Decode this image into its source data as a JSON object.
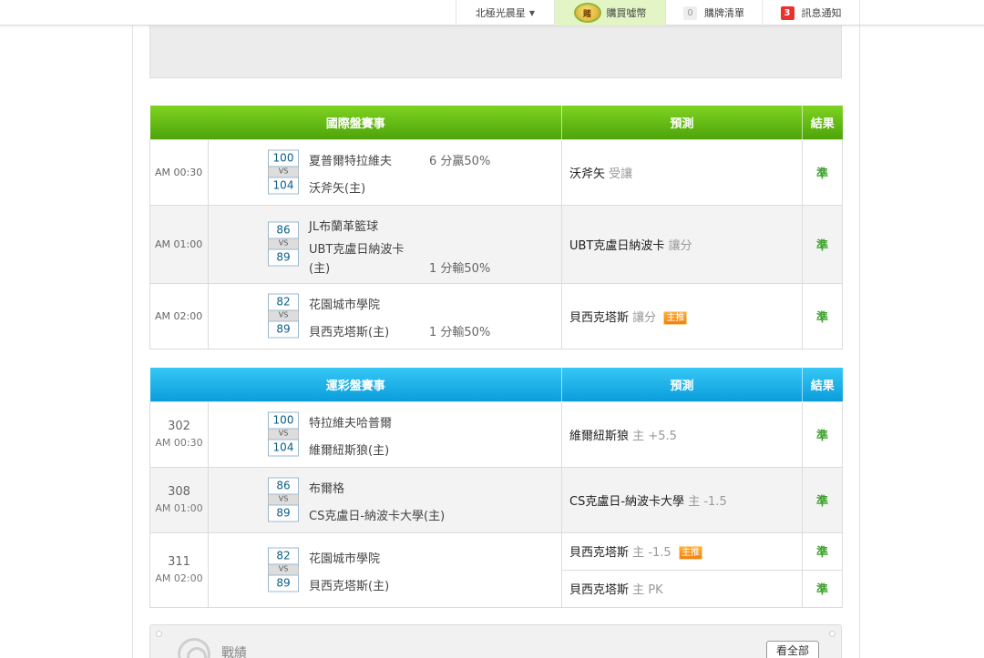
{
  "nav": {
    "user": "北極光晨星",
    "buy_icon": "賭",
    "buy": "購買噓幣",
    "cart_count": "0",
    "cart": "購牌清單",
    "msg_count": "3",
    "messages": "訊息通知"
  },
  "intl": {
    "headers": [
      "國際盤賽事",
      "預測",
      "結果"
    ],
    "rows": [
      {
        "time": "AM 00:30",
        "score_a": "100",
        "vs": "VS",
        "score_b": "104",
        "team_a": "夏普爾特拉維夫",
        "team_b": "沃斧矢(主)",
        "record": "6 分贏50%",
        "pick": "沃斧矢",
        "type": "受讓",
        "result": "準"
      },
      {
        "time": "AM 01:00",
        "score_a": "86",
        "vs": "VS",
        "score_b": "89",
        "team_a": "JL布蘭革籃球",
        "team_b": "UBT克盧日納波卡",
        "team_b2": "(主)",
        "record": "1 分輸50%",
        "pick": "UBT克盧日納波卡",
        "type": "讓分",
        "result": "準"
      },
      {
        "time": "AM 02:00",
        "score_a": "82",
        "vs": "VS",
        "score_b": "89",
        "team_a": "花園城市學院",
        "team_b": "貝西克塔斯(主)",
        "record": "1 分輸50%",
        "pick": "貝西克塔斯",
        "type": "讓分",
        "badge": "主推",
        "result": "準"
      }
    ]
  },
  "lottery": {
    "headers": [
      "運彩盤賽事",
      "預測",
      "結果"
    ],
    "rows": [
      {
        "no": "302",
        "time": "AM 00:30",
        "score_a": "100",
        "vs": "VS",
        "score_b": "104",
        "team_a": "特拉維夫哈普爾",
        "team_b": "維爾紐斯狼(主)",
        "pick": "維爾紐斯狼",
        "side": "主",
        "line": "+5.5",
        "result": "準"
      },
      {
        "no": "308",
        "time": "AM 01:00",
        "score_a": "86",
        "vs": "VS",
        "score_b": "89",
        "team_a": "布爾格",
        "team_b": "CS克盧日-納波卡大學(主)",
        "pick": "CS克盧日-納波卡大學",
        "side": "主",
        "line": "-1.5",
        "result": "準"
      },
      {
        "no": "311",
        "time": "AM 02:00",
        "score_a": "82",
        "vs": "VS",
        "score_b": "89",
        "team_a": "花園城市學院",
        "team_b": "貝西克塔斯(主)",
        "picks": [
          {
            "pick": "貝西克塔斯",
            "side": "主",
            "line": "-1.5",
            "badge": "主推",
            "result": "準"
          },
          {
            "pick": "貝西克塔斯",
            "side": "主",
            "line": "PK",
            "result": "準"
          }
        ]
      }
    ]
  },
  "record_panel": {
    "title": "戰績",
    "button": "看全部"
  }
}
